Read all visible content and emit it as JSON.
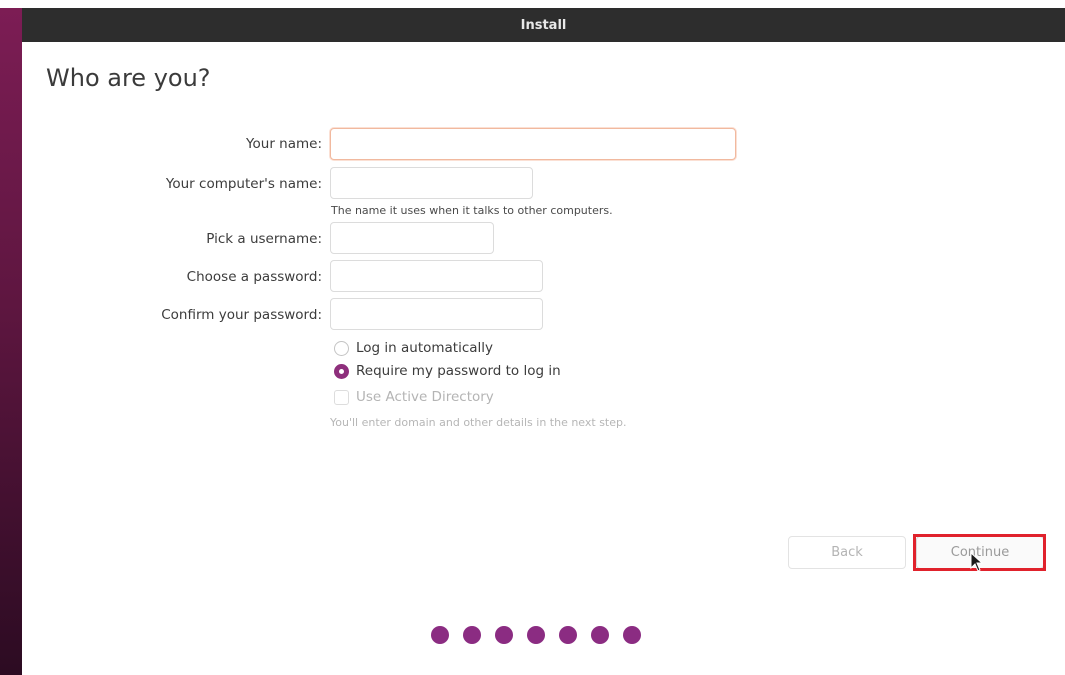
{
  "window": {
    "title": "Install"
  },
  "page": {
    "title": "Who are you?"
  },
  "form": {
    "name_label": "Your name:",
    "name_value": "",
    "computer_label": "Your computer's name:",
    "computer_value": "",
    "computer_hint": "The name it uses when it talks to other computers.",
    "username_label": "Pick a username:",
    "username_value": "",
    "password_label": "Choose a password:",
    "password_value": "",
    "confirm_label": "Confirm your password:",
    "confirm_value": ""
  },
  "login_options": {
    "auto_login_label": "Log in automatically",
    "auto_login_selected": false,
    "require_password_label": "Require my password to log in",
    "require_password_selected": true,
    "active_directory_label": "Use Active Directory",
    "active_directory_checked": false,
    "active_directory_hint": "You'll enter domain and other details in the next step."
  },
  "buttons": {
    "back_label": "Back",
    "continue_label": "Continue"
  },
  "progress": {
    "total_steps": 7
  },
  "colors": {
    "accent": "#8e2f7c",
    "titlebar": "#2d2d2d",
    "highlight": "#e0222c",
    "focus_border": "#f1b99f"
  }
}
